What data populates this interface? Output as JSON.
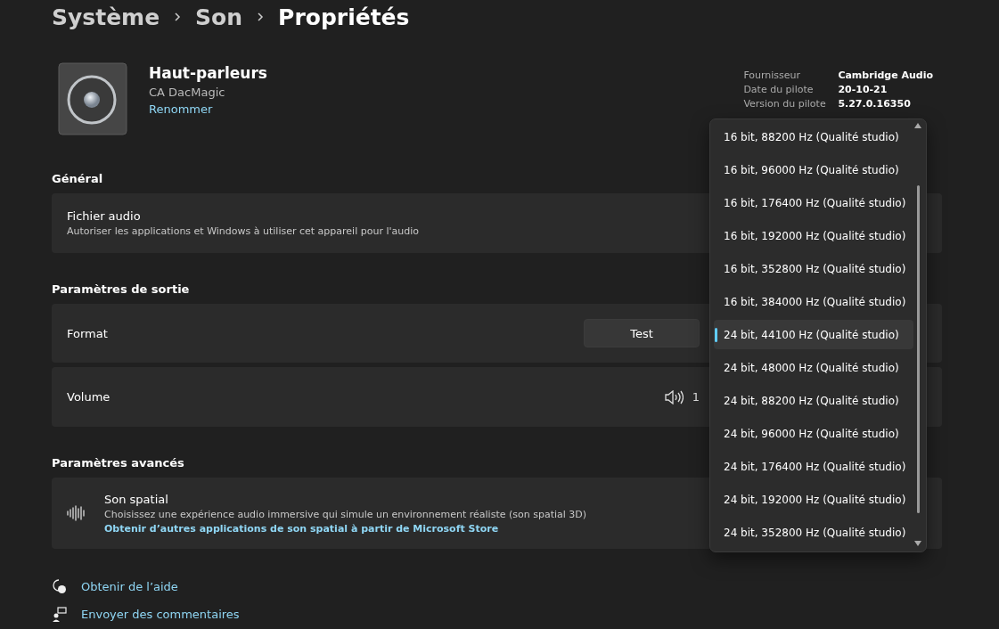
{
  "breadcrumb": [
    "Système",
    "Son",
    "Propriétés"
  ],
  "device": {
    "name": "Haut-parleurs",
    "model": "CA DacMagic",
    "rename": "Renommer"
  },
  "driver_info": [
    {
      "label": "Fournisseur",
      "value": "Cambridge Audio"
    },
    {
      "label": "Date du pilote",
      "value": "20-10-21"
    },
    {
      "label": "Version du pilote",
      "value": "5.27.0.16350"
    }
  ],
  "general": {
    "heading": "Général",
    "title": "Fichier audio",
    "description": "Autoriser les applications et Windows à utiliser cet appareil pour l'audio"
  },
  "output": {
    "heading": "Paramètres de sortie",
    "format_label": "Format",
    "test_button": "Test",
    "volume_label": "Volume",
    "volume_value": "1"
  },
  "advanced": {
    "heading": "Paramètres avancés",
    "title": "Son spatial",
    "description": "Choisissez une expérience audio immersive qui simule un environnement réaliste (son spatial 3D)",
    "link": "Obtenir d’autres applications de son spatial à partir de Microsoft Store"
  },
  "footer_links": [
    "Obtenir de l’aide",
    "Envoyer des commentaires"
  ],
  "format_dropdown": [
    {
      "label": "16 bit, 88200 Hz (Qualité studio)",
      "selected": false
    },
    {
      "label": "16 bit, 96000 Hz (Qualité studio)",
      "selected": false
    },
    {
      "label": "16 bit, 176400 Hz (Qualité studio)",
      "selected": false
    },
    {
      "label": "16 bit, 192000 Hz (Qualité studio)",
      "selected": false
    },
    {
      "label": "16 bit, 352800 Hz (Qualité studio)",
      "selected": false
    },
    {
      "label": "16 bit, 384000 Hz (Qualité studio)",
      "selected": false
    },
    {
      "label": "24 bit, 44100 Hz (Qualité studio)",
      "selected": true
    },
    {
      "label": "24 bit, 48000 Hz (Qualité studio)",
      "selected": false
    },
    {
      "label": "24 bit, 88200 Hz (Qualité studio)",
      "selected": false
    },
    {
      "label": "24 bit, 96000 Hz (Qualité studio)",
      "selected": false
    },
    {
      "label": "24 bit, 176400 Hz (Qualité studio)",
      "selected": false
    },
    {
      "label": "24 bit, 192000 Hz (Qualité studio)",
      "selected": false
    },
    {
      "label": "24 bit, 352800 Hz (Qualité studio)",
      "selected": false
    }
  ]
}
